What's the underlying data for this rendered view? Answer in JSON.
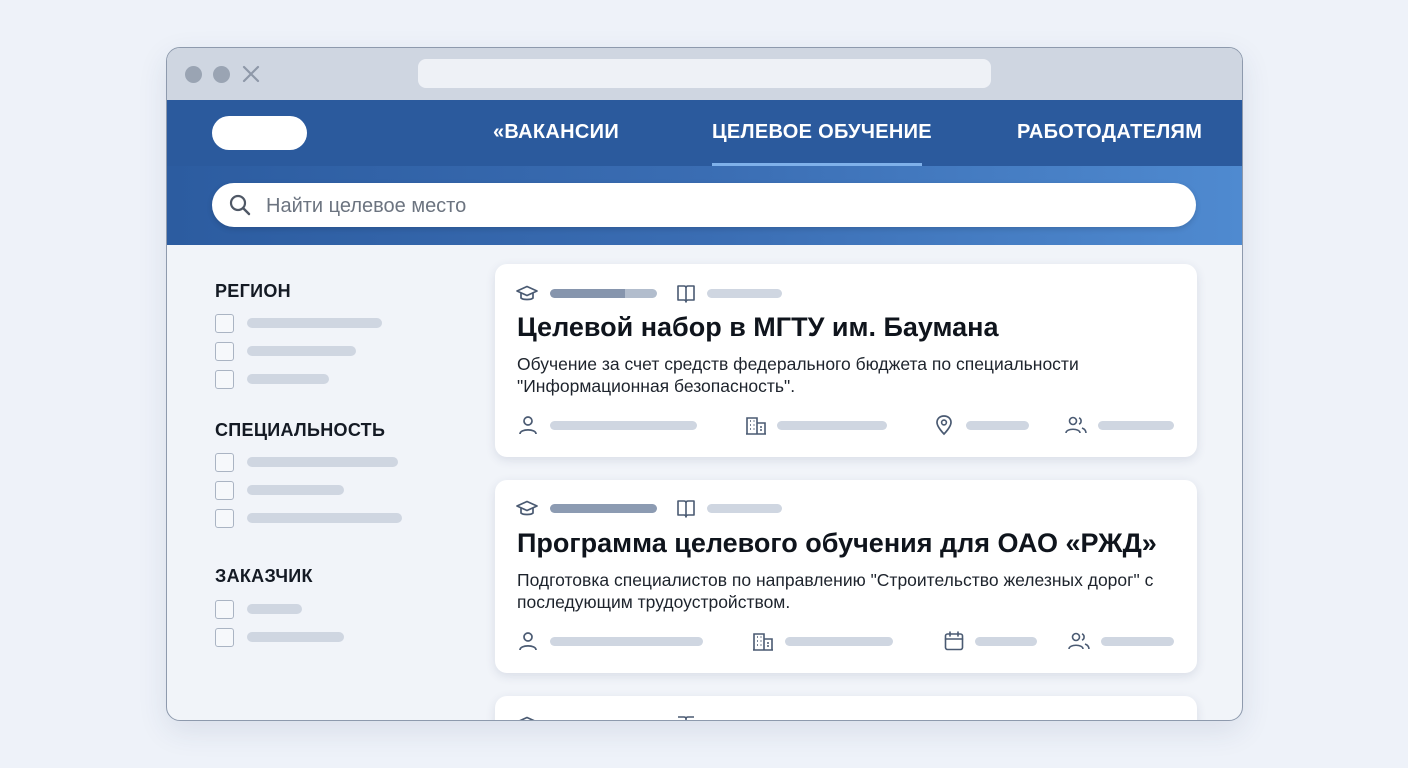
{
  "nav": {
    "items": [
      "«ВАКАНСИИ",
      "ЦЕЛЕВОЕ ОБУЧЕНИЕ",
      "РАБОТОДАТЕЛЯМ"
    ],
    "active_index": 1
  },
  "search": {
    "placeholder": "Найти целевое место"
  },
  "filters": {
    "region": {
      "title": "РЕГИОН"
    },
    "specialty": {
      "title": "СПЕЦИАЛЬНОСТЬ"
    },
    "customer": {
      "title": "ЗАКАЗЧИК"
    }
  },
  "cards": [
    {
      "title": "Целевой набор в МГТУ им. Баумана",
      "description": "Обучение за счет средств федерального бюджета по специальности \"Информационная безопасность\".",
      "meta_icons": [
        "person-icon",
        "building-icon",
        "location-pin-icon",
        "users-icon"
      ]
    },
    {
      "title": "Программа целевого обучения для ОАО «РЖД»",
      "description": "Подготовка специалистов по направлению \"Строительство железных дорог\" с последующим трудоустройством.",
      "meta_icons": [
        "person-icon",
        "building-icon",
        "calendar-icon",
        "users-icon"
      ]
    }
  ],
  "colors": {
    "nav_bg": "#2b5a9d",
    "accent_underline": "#7fb1ea",
    "page_bg": "#eef2f9"
  }
}
